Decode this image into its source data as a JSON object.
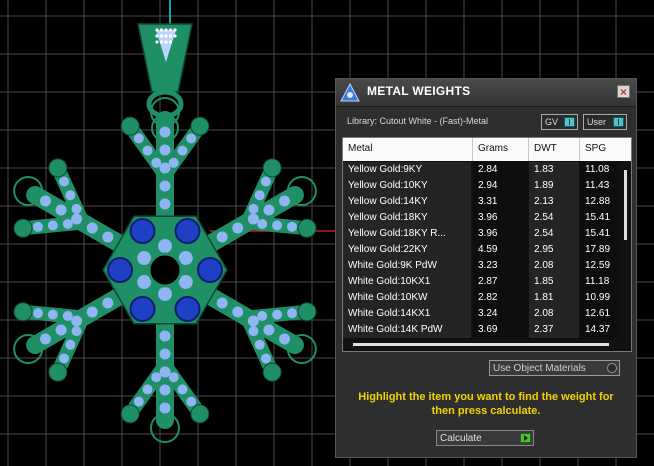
{
  "panel": {
    "title": "METAL WEIGHTS",
    "close_glyph": "×",
    "library_label": "Library: Cutout White - (Fast)-Metal",
    "toggles": [
      {
        "label": "GV",
        "on": true
      },
      {
        "label": "User",
        "on": true
      }
    ],
    "columns": [
      "Metal",
      "Grams",
      "DWT",
      "SPG"
    ],
    "rows": [
      [
        "Yellow Gold:9KY",
        "2.84",
        "1.83",
        "11.08"
      ],
      [
        "Yellow Gold:10KY",
        "2.94",
        "1.89",
        "11.43"
      ],
      [
        "Yellow Gold:14KY",
        "3.31",
        "2.13",
        "12.88"
      ],
      [
        "Yellow Gold:18KY",
        "3.96",
        "2.54",
        "15.41"
      ],
      [
        "Yellow Gold:18KY R...",
        "3.96",
        "2.54",
        "15.41"
      ],
      [
        "Yellow Gold:22KY",
        "4.59",
        "2.95",
        "17.89"
      ],
      [
        "White Gold:9K PdW",
        "3.23",
        "2.08",
        "12.59"
      ],
      [
        "White Gold:10KX1",
        "2.87",
        "1.85",
        "11.18"
      ],
      [
        "White Gold:10KW",
        "2.82",
        "1.81",
        "10.99"
      ],
      [
        "White Gold:14KX1",
        "3.24",
        "2.08",
        "12.61"
      ],
      [
        "White Gold:14K PdW",
        "3.69",
        "2.37",
        "14.37"
      ]
    ],
    "use_object_materials": "Use Object Materials",
    "instructions": "Highlight the item you want to find the weight for then press calculate.",
    "calculate_label": "Calculate"
  },
  "colors": {
    "background": "#000000",
    "grid": "#4a4a4a",
    "metal_green": "#1f8f66",
    "stone_light": "#8fb6f2",
    "stone_dark": "#1f3fc4",
    "highlight_text": "#f2d200"
  },
  "icons": [
    "app-logo-icon",
    "close-icon",
    "toggle-switch-icon",
    "play-arrow-icon"
  ]
}
